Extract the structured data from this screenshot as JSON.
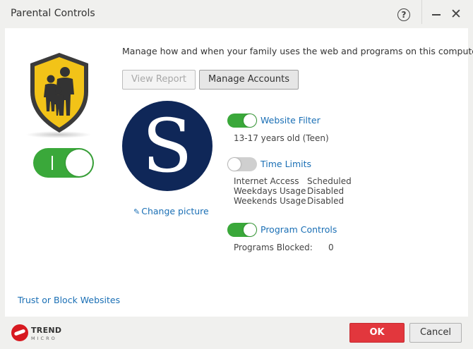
{
  "window": {
    "title": "Parental Controls"
  },
  "header": {
    "description": "Manage how and when your family uses the web and programs on this computer."
  },
  "buttons": {
    "view_report": "View Report",
    "manage_accounts": "Manage Accounts",
    "ok": "OK",
    "cancel": "Cancel"
  },
  "profile": {
    "avatar_letter": "S",
    "change_picture": "Change picture"
  },
  "master_toggle": {
    "state": "on"
  },
  "features": {
    "website_filter": {
      "label": "Website Filter",
      "state": "on",
      "level": "13-17 years old (Teen)"
    },
    "time_limits": {
      "label": "Time Limits",
      "state": "off",
      "rows": [
        {
          "key": "Internet Access",
          "value": "Scheduled"
        },
        {
          "key": "Weekdays Usage",
          "value": "Disabled"
        },
        {
          "key": "Weekends Usage",
          "value": "Disabled"
        }
      ]
    },
    "program_controls": {
      "label": "Program Controls",
      "state": "on",
      "blocked_label": "Programs Blocked:",
      "blocked_value": "0"
    }
  },
  "links": {
    "trust_block": "Trust or Block Websites"
  },
  "branding": {
    "line1": "TREND",
    "line2": "MICRO"
  },
  "colors": {
    "toggle_on": "#3aa83a",
    "toggle_off": "#cfcfcf",
    "link": "#1a6fb5",
    "ok_button": "#e2373d",
    "shield_yellow": "#f2c318",
    "avatar_bg": "#0f2758"
  },
  "icons": {
    "help": "help-icon",
    "minimize": "minimize-icon",
    "close": "close-icon",
    "shield": "family-shield-icon",
    "pencil": "pencil-icon",
    "logo": "trend-micro-logo-icon"
  }
}
